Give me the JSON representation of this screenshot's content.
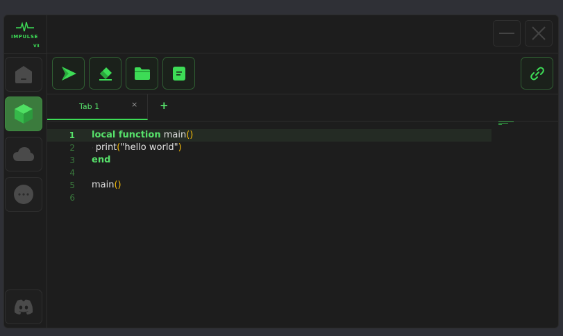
{
  "app": {
    "name": "IMPULSE",
    "version": "V3",
    "accent": "#3ddc56"
  },
  "sidebar": {
    "items": [
      {
        "name": "home",
        "icon": "home-icon"
      },
      {
        "name": "scripts",
        "icon": "cube-icon",
        "active": true
      },
      {
        "name": "cloud",
        "icon": "cloud-icon"
      },
      {
        "name": "more",
        "icon": "more-icon"
      }
    ],
    "footer": {
      "name": "discord",
      "icon": "discord-icon"
    }
  },
  "window_controls": {
    "minimize": "minimize-icon",
    "close": "close-icon"
  },
  "toolbar": {
    "buttons": [
      "execute-icon",
      "eraser-icon",
      "folder-icon",
      "save-icon"
    ],
    "attach": "link-icon"
  },
  "tabs": [
    {
      "label": "Tab 1",
      "close": "×"
    }
  ],
  "tab_add": "+",
  "editor": {
    "current_line": 1,
    "lines": [
      {
        "n": "1"
      },
      {
        "n": "2"
      },
      {
        "n": "3"
      },
      {
        "n": "4"
      },
      {
        "n": "5"
      },
      {
        "n": "6"
      }
    ],
    "code": {
      "l1_kw": "local function",
      "l1_name": " main",
      "l1_paren": "()",
      "l2_indent": "· ",
      "l2_fn": "print",
      "l2_open": "(",
      "l2_str": "\"hello world\"",
      "l2_close": ")",
      "l3_kw": "end",
      "l5_name": "main",
      "l5_paren": "()"
    }
  }
}
